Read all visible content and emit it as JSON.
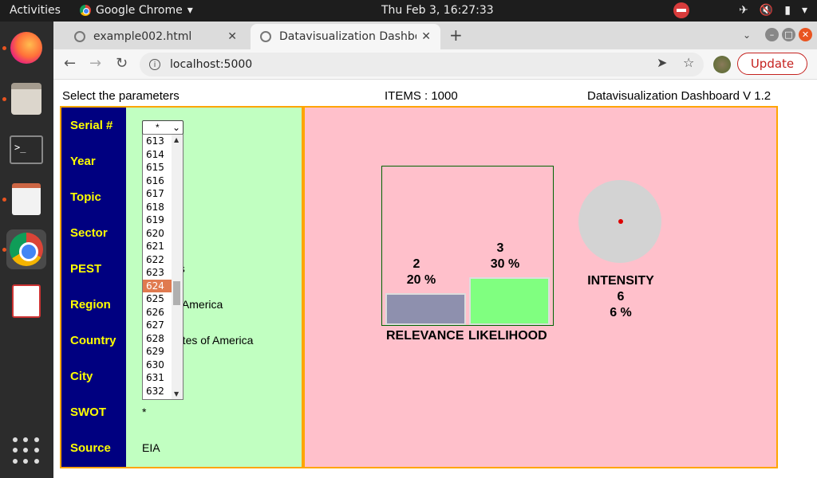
{
  "topbar": {
    "activities": "Activities",
    "app_name": "Google Chrome",
    "clock": "Thu Feb  3, 16:27:33"
  },
  "browser": {
    "tabs": [
      {
        "title": "example002.html",
        "active": false
      },
      {
        "title": "Datavisualization Dashbo",
        "active": true
      }
    ],
    "url": "localhost:5000",
    "update_label": "Update"
  },
  "header": {
    "left": "Select the parameters",
    "center": "ITEMS : 1000",
    "right": "Datavisualization Dashboard V 1.2"
  },
  "params": [
    {
      "label": "Serial #",
      "value": ""
    },
    {
      "label": "Year",
      "value": ""
    },
    {
      "label": "Topic",
      "value": ""
    },
    {
      "label": "Sector",
      "value": ""
    },
    {
      "label": "PEST",
      "value": "es"
    },
    {
      "label": "Region",
      "value": "n America"
    },
    {
      "label": "Country",
      "value": "tates of America"
    },
    {
      "label": "City",
      "value": ""
    },
    {
      "label": "SWOT",
      "value": "*"
    },
    {
      "label": "Source",
      "value": "EIA"
    }
  ],
  "serial_select": {
    "selected": "*",
    "options": [
      "613",
      "614",
      "615",
      "616",
      "617",
      "618",
      "619",
      "620",
      "621",
      "622",
      "623",
      "624",
      "625",
      "626",
      "627",
      "628",
      "629",
      "630",
      "631",
      "632"
    ],
    "highlighted": "624"
  },
  "chart_data": {
    "type": "bar",
    "categories": [
      "RELEVANCE",
      "LIKELIHOOD"
    ],
    "values": [
      2,
      3
    ],
    "percent_labels": [
      "20 %",
      "30 %"
    ],
    "colors": [
      "#8e90ae",
      "#80ff80"
    ],
    "ylim": [
      0,
      10
    ]
  },
  "intensity": {
    "label": "INTENSITY",
    "value": "6",
    "percent": "6 %",
    "level": 0.06
  }
}
